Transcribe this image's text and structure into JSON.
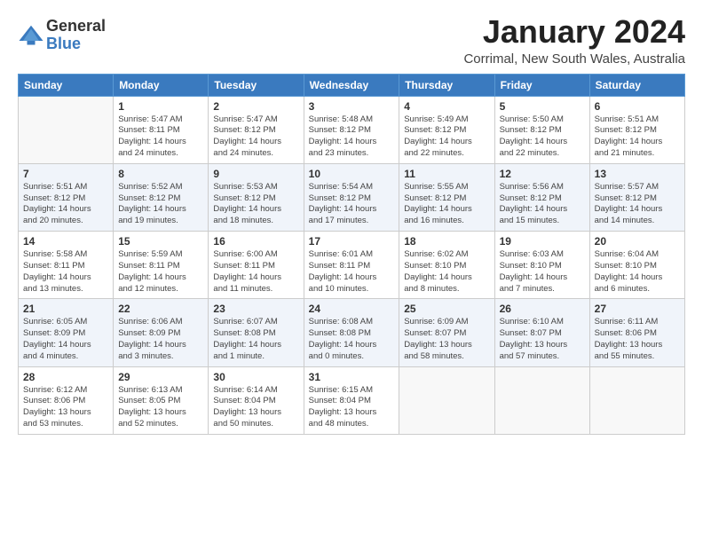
{
  "logo": {
    "text_general": "General",
    "text_blue": "Blue"
  },
  "title": "January 2024",
  "subtitle": "Corrimal, New South Wales, Australia",
  "weekdays": [
    "Sunday",
    "Monday",
    "Tuesday",
    "Wednesday",
    "Thursday",
    "Friday",
    "Saturday"
  ],
  "weeks": [
    [
      {
        "day": "",
        "detail": ""
      },
      {
        "day": "1",
        "detail": "Sunrise: 5:47 AM\nSunset: 8:11 PM\nDaylight: 14 hours\nand 24 minutes."
      },
      {
        "day": "2",
        "detail": "Sunrise: 5:47 AM\nSunset: 8:12 PM\nDaylight: 14 hours\nand 24 minutes."
      },
      {
        "day": "3",
        "detail": "Sunrise: 5:48 AM\nSunset: 8:12 PM\nDaylight: 14 hours\nand 23 minutes."
      },
      {
        "day": "4",
        "detail": "Sunrise: 5:49 AM\nSunset: 8:12 PM\nDaylight: 14 hours\nand 22 minutes."
      },
      {
        "day": "5",
        "detail": "Sunrise: 5:50 AM\nSunset: 8:12 PM\nDaylight: 14 hours\nand 22 minutes."
      },
      {
        "day": "6",
        "detail": "Sunrise: 5:51 AM\nSunset: 8:12 PM\nDaylight: 14 hours\nand 21 minutes."
      }
    ],
    [
      {
        "day": "7",
        "detail": "Sunrise: 5:51 AM\nSunset: 8:12 PM\nDaylight: 14 hours\nand 20 minutes."
      },
      {
        "day": "8",
        "detail": "Sunrise: 5:52 AM\nSunset: 8:12 PM\nDaylight: 14 hours\nand 19 minutes."
      },
      {
        "day": "9",
        "detail": "Sunrise: 5:53 AM\nSunset: 8:12 PM\nDaylight: 14 hours\nand 18 minutes."
      },
      {
        "day": "10",
        "detail": "Sunrise: 5:54 AM\nSunset: 8:12 PM\nDaylight: 14 hours\nand 17 minutes."
      },
      {
        "day": "11",
        "detail": "Sunrise: 5:55 AM\nSunset: 8:12 PM\nDaylight: 14 hours\nand 16 minutes."
      },
      {
        "day": "12",
        "detail": "Sunrise: 5:56 AM\nSunset: 8:12 PM\nDaylight: 14 hours\nand 15 minutes."
      },
      {
        "day": "13",
        "detail": "Sunrise: 5:57 AM\nSunset: 8:12 PM\nDaylight: 14 hours\nand 14 minutes."
      }
    ],
    [
      {
        "day": "14",
        "detail": "Sunrise: 5:58 AM\nSunset: 8:11 PM\nDaylight: 14 hours\nand 13 minutes."
      },
      {
        "day": "15",
        "detail": "Sunrise: 5:59 AM\nSunset: 8:11 PM\nDaylight: 14 hours\nand 12 minutes."
      },
      {
        "day": "16",
        "detail": "Sunrise: 6:00 AM\nSunset: 8:11 PM\nDaylight: 14 hours\nand 11 minutes."
      },
      {
        "day": "17",
        "detail": "Sunrise: 6:01 AM\nSunset: 8:11 PM\nDaylight: 14 hours\nand 10 minutes."
      },
      {
        "day": "18",
        "detail": "Sunrise: 6:02 AM\nSunset: 8:10 PM\nDaylight: 14 hours\nand 8 minutes."
      },
      {
        "day": "19",
        "detail": "Sunrise: 6:03 AM\nSunset: 8:10 PM\nDaylight: 14 hours\nand 7 minutes."
      },
      {
        "day": "20",
        "detail": "Sunrise: 6:04 AM\nSunset: 8:10 PM\nDaylight: 14 hours\nand 6 minutes."
      }
    ],
    [
      {
        "day": "21",
        "detail": "Sunrise: 6:05 AM\nSunset: 8:09 PM\nDaylight: 14 hours\nand 4 minutes."
      },
      {
        "day": "22",
        "detail": "Sunrise: 6:06 AM\nSunset: 8:09 PM\nDaylight: 14 hours\nand 3 minutes."
      },
      {
        "day": "23",
        "detail": "Sunrise: 6:07 AM\nSunset: 8:08 PM\nDaylight: 14 hours\nand 1 minute."
      },
      {
        "day": "24",
        "detail": "Sunrise: 6:08 AM\nSunset: 8:08 PM\nDaylight: 14 hours\nand 0 minutes."
      },
      {
        "day": "25",
        "detail": "Sunrise: 6:09 AM\nSunset: 8:07 PM\nDaylight: 13 hours\nand 58 minutes."
      },
      {
        "day": "26",
        "detail": "Sunrise: 6:10 AM\nSunset: 8:07 PM\nDaylight: 13 hours\nand 57 minutes."
      },
      {
        "day": "27",
        "detail": "Sunrise: 6:11 AM\nSunset: 8:06 PM\nDaylight: 13 hours\nand 55 minutes."
      }
    ],
    [
      {
        "day": "28",
        "detail": "Sunrise: 6:12 AM\nSunset: 8:06 PM\nDaylight: 13 hours\nand 53 minutes."
      },
      {
        "day": "29",
        "detail": "Sunrise: 6:13 AM\nSunset: 8:05 PM\nDaylight: 13 hours\nand 52 minutes."
      },
      {
        "day": "30",
        "detail": "Sunrise: 6:14 AM\nSunset: 8:04 PM\nDaylight: 13 hours\nand 50 minutes."
      },
      {
        "day": "31",
        "detail": "Sunrise: 6:15 AM\nSunset: 8:04 PM\nDaylight: 13 hours\nand 48 minutes."
      },
      {
        "day": "",
        "detail": ""
      },
      {
        "day": "",
        "detail": ""
      },
      {
        "day": "",
        "detail": ""
      }
    ]
  ]
}
